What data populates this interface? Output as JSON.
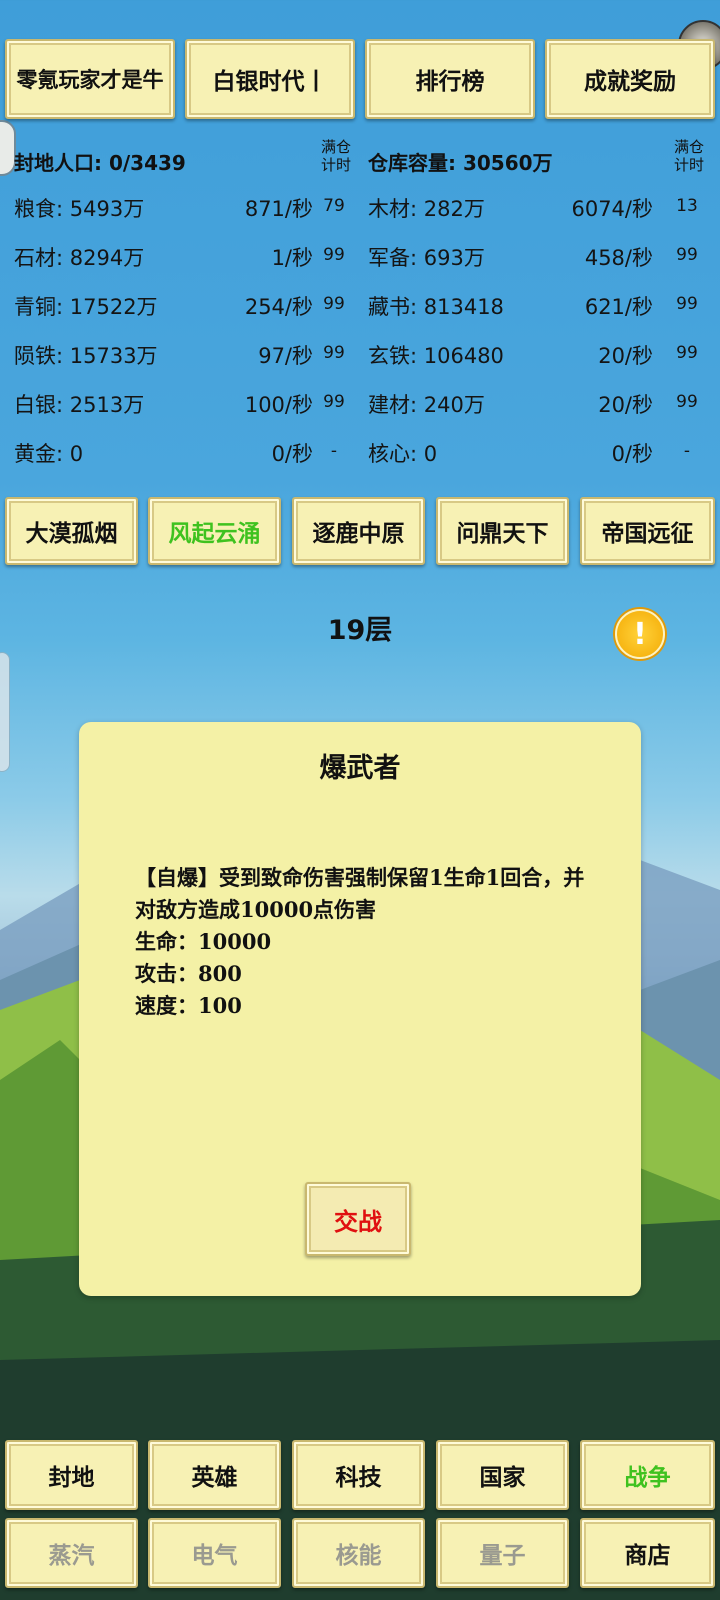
{
  "top_buttons": [
    "零氪玩家才是牛",
    "白银时代丨",
    "排行榜",
    "成就奖励"
  ],
  "stats": {
    "population_label": "封地人口: 0/3439",
    "storage_label": "仓库容量: 30560万",
    "timer_header_line1": "满仓",
    "timer_header_line2": "计时"
  },
  "resources_left": [
    {
      "name": "粮食: 5493万",
      "rate": "871/秒",
      "timer": "79"
    },
    {
      "name": "石材: 8294万",
      "rate": "1/秒",
      "timer": "99"
    },
    {
      "name": "青铜: 17522万",
      "rate": "254/秒",
      "timer": "99"
    },
    {
      "name": "陨铁: 15733万",
      "rate": "97/秒",
      "timer": "99"
    },
    {
      "name": "白银: 2513万",
      "rate": "100/秒",
      "timer": "99"
    },
    {
      "name": "黄金: 0",
      "rate": "0/秒",
      "timer": "-"
    }
  ],
  "resources_right": [
    {
      "name": "木材: 282万",
      "rate": "6074/秒",
      "timer": "13"
    },
    {
      "name": "军备: 693万",
      "rate": "458/秒",
      "timer": "99"
    },
    {
      "name": "藏书: 813418",
      "rate": "621/秒",
      "timer": "99"
    },
    {
      "name": "玄铁: 106480",
      "rate": "20/秒",
      "timer": "99"
    },
    {
      "name": "建材: 240万",
      "rate": "20/秒",
      "timer": "99"
    },
    {
      "name": "核心: 0",
      "rate": "0/秒",
      "timer": "-"
    }
  ],
  "era_tabs": [
    "大漠孤烟",
    "风起云涌",
    "逐鹿中原",
    "问鼎天下",
    "帝国远征"
  ],
  "active_era_index": 1,
  "floor_label": "19层",
  "warn_icon": "!",
  "enemy": {
    "name": "爆武者",
    "skill": "【自爆】受到致命伤害强制保留1生命1回合，并对敌方造成10000点伤害",
    "hp": "生命：10000",
    "attack": "攻击：800",
    "speed": "速度：100",
    "fight_label": "交战"
  },
  "nav_row1": [
    "封地",
    "英雄",
    "科技",
    "国家",
    "战争"
  ],
  "nav_row2": [
    "蒸汽",
    "电气",
    "核能",
    "量子",
    "商店"
  ],
  "colors": {
    "active": "#3fc21f",
    "fight": "#e01010",
    "disabled": "#9a9a90"
  }
}
